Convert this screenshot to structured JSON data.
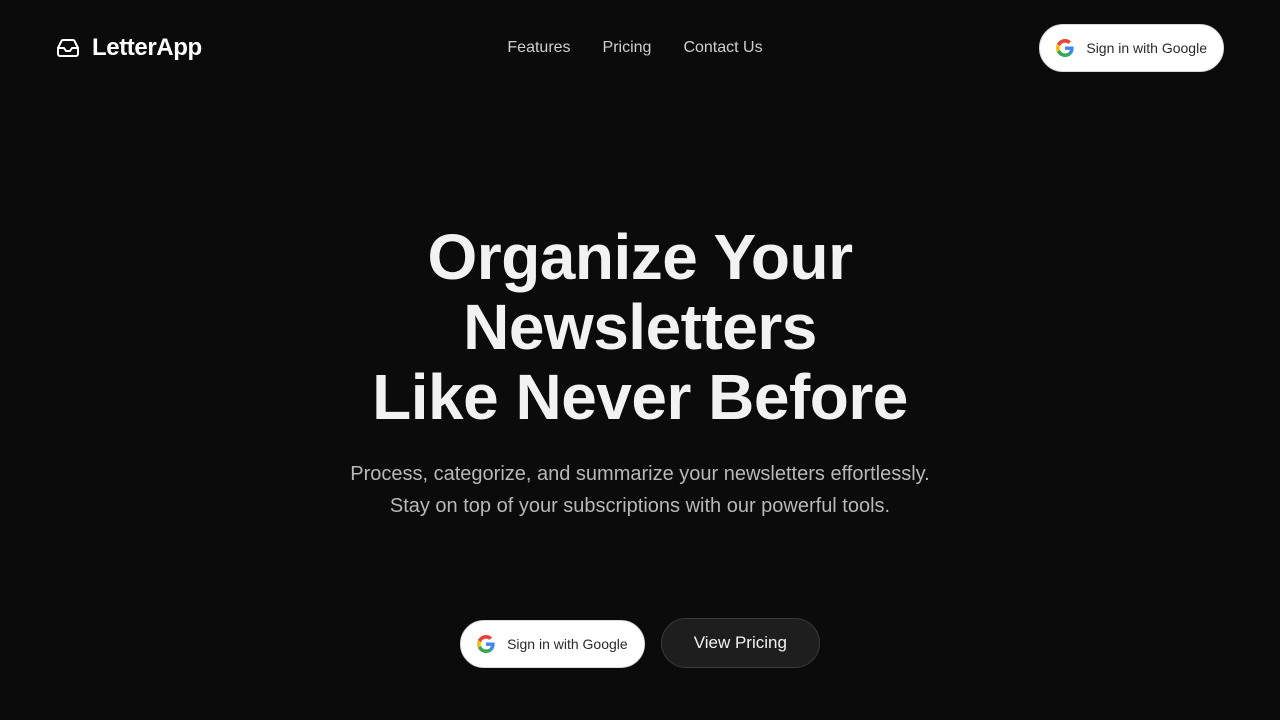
{
  "brand": {
    "name": "LetterApp",
    "icon": "inbox-icon"
  },
  "nav": {
    "items": [
      "Features",
      "Pricing",
      "Contact Us"
    ]
  },
  "header": {
    "signin_label": "Sign in with Google"
  },
  "hero": {
    "title_lines": [
      "Organize Your",
      "Newsletters",
      "Like Never Before"
    ],
    "subtitle": "Process, categorize, and summarize your newsletters effortlessly. Stay on top of your subscriptions with our powerful tools.",
    "signin_label": "Sign in with Google",
    "pricing_label": "View Pricing"
  },
  "colors": {
    "background": "#0b0b0b",
    "text": "#ffffff",
    "muted": "#b8b8b8",
    "google_blue": "#4285F4",
    "google_red": "#EA4335",
    "google_yellow": "#FBBC05",
    "google_green": "#34A853"
  }
}
